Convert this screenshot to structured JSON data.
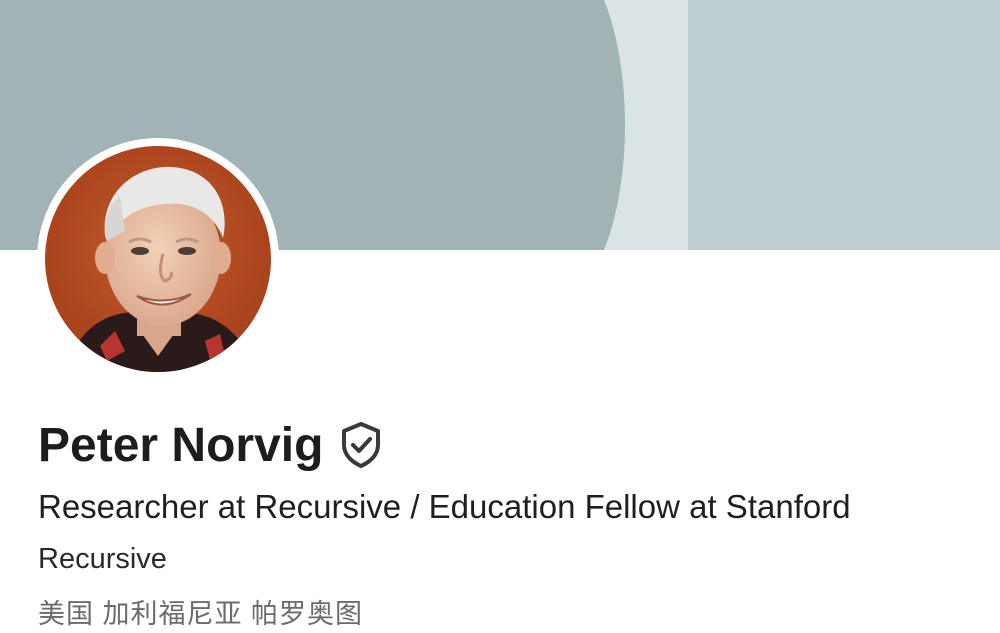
{
  "profile": {
    "name": "Peter Norvig",
    "headline": "Researcher at Recursive / Education Fellow at Stanford",
    "company": "Recursive",
    "location": "美国 加利福尼亚 帕罗奥图",
    "verified_icon": "verified-shield-check-icon"
  },
  "colors": {
    "cover_main": "#a1b3b5",
    "cover_light": "#dae4e6",
    "cover_right": "#bfcfd3",
    "avatar_background": "#b54a22"
  }
}
